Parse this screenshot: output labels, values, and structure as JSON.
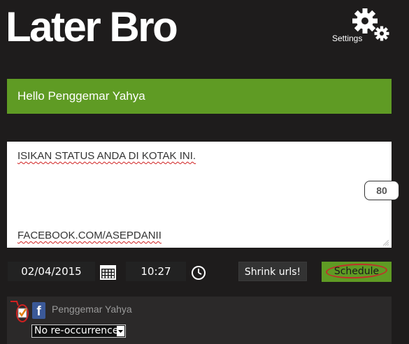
{
  "app": {
    "title": "Later Bro"
  },
  "settings": {
    "label": "Settings",
    "icon": "gear-icon"
  },
  "greeting": {
    "text": "Hello Penggemar Yahya"
  },
  "status": {
    "line1": "ISIKAN STATUS ANDA DI KOTAK INI.",
    "line2": "FACEBOOK.COM/ASEPDANII",
    "char_count": "80"
  },
  "schedule_controls": {
    "date": "02/04/2015",
    "time": "10:27",
    "shrink_label": "Shrink urls!",
    "schedule_label": "Schedule"
  },
  "account": {
    "network": "facebook",
    "name": "Penggemar Yahya",
    "recurrence": "No re-occurrence"
  },
  "colors": {
    "background": "#1e1c1c",
    "accent_green": "#5f9b24",
    "facebook_blue": "#3b5998",
    "annotation_red": "#c0302a"
  }
}
